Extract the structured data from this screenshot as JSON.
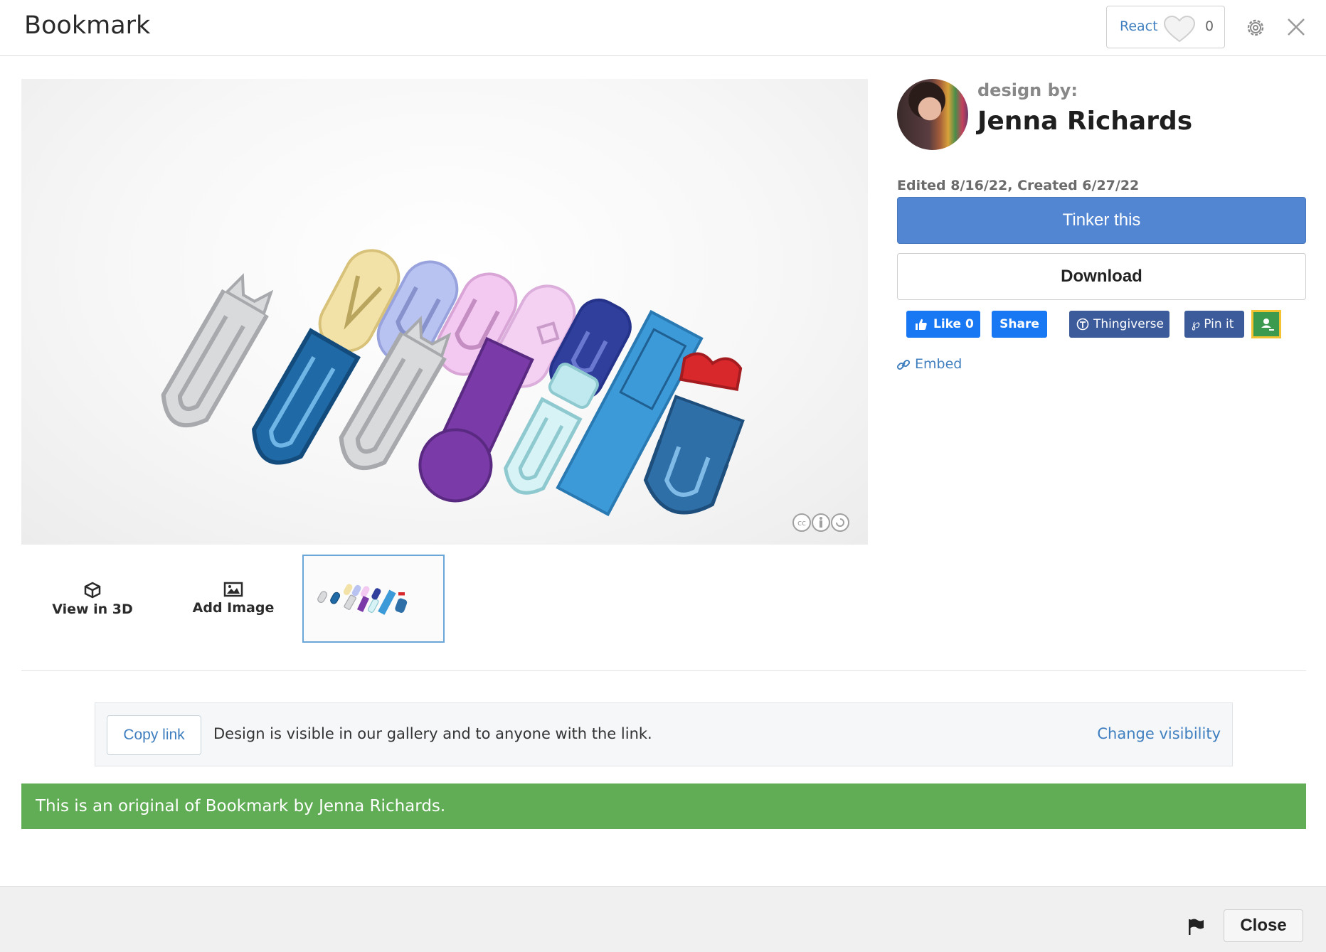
{
  "header": {
    "title": "Bookmark",
    "react_label": "React",
    "react_count": "0",
    "icons": [
      "heart-icon",
      "gear-icon",
      "close-icon"
    ]
  },
  "preview": {
    "license_icons": [
      "cc-icon",
      "attribution-icon",
      "share-alike-icon"
    ]
  },
  "thumb_tools": {
    "view_3d": "View in 3D",
    "add_image": "Add Image"
  },
  "designer": {
    "design_by_label": "design by:",
    "name": "Jenna Richards",
    "dates": "Edited 8/16/22, Created 6/27/22"
  },
  "actions": {
    "tinker": "Tinker this",
    "download": "Download"
  },
  "social": {
    "like": "Like 0",
    "share": "Share",
    "thingiverse": "Thingiverse",
    "pin": "Pin it",
    "embed": "Embed"
  },
  "visibility": {
    "copy_link": "Copy link",
    "text": "Design is visible in our gallery and to anyone with the link.",
    "change": "Change visibility"
  },
  "original_banner": "This is an original of Bookmark by Jenna Richards.",
  "footer": {
    "close": "Close"
  },
  "colors": {
    "primary": "#5286d2",
    "link": "#3f7fbf",
    "success": "#61ad55",
    "facebook": "#1877f2",
    "thingiverse": "#3b5b9b"
  }
}
